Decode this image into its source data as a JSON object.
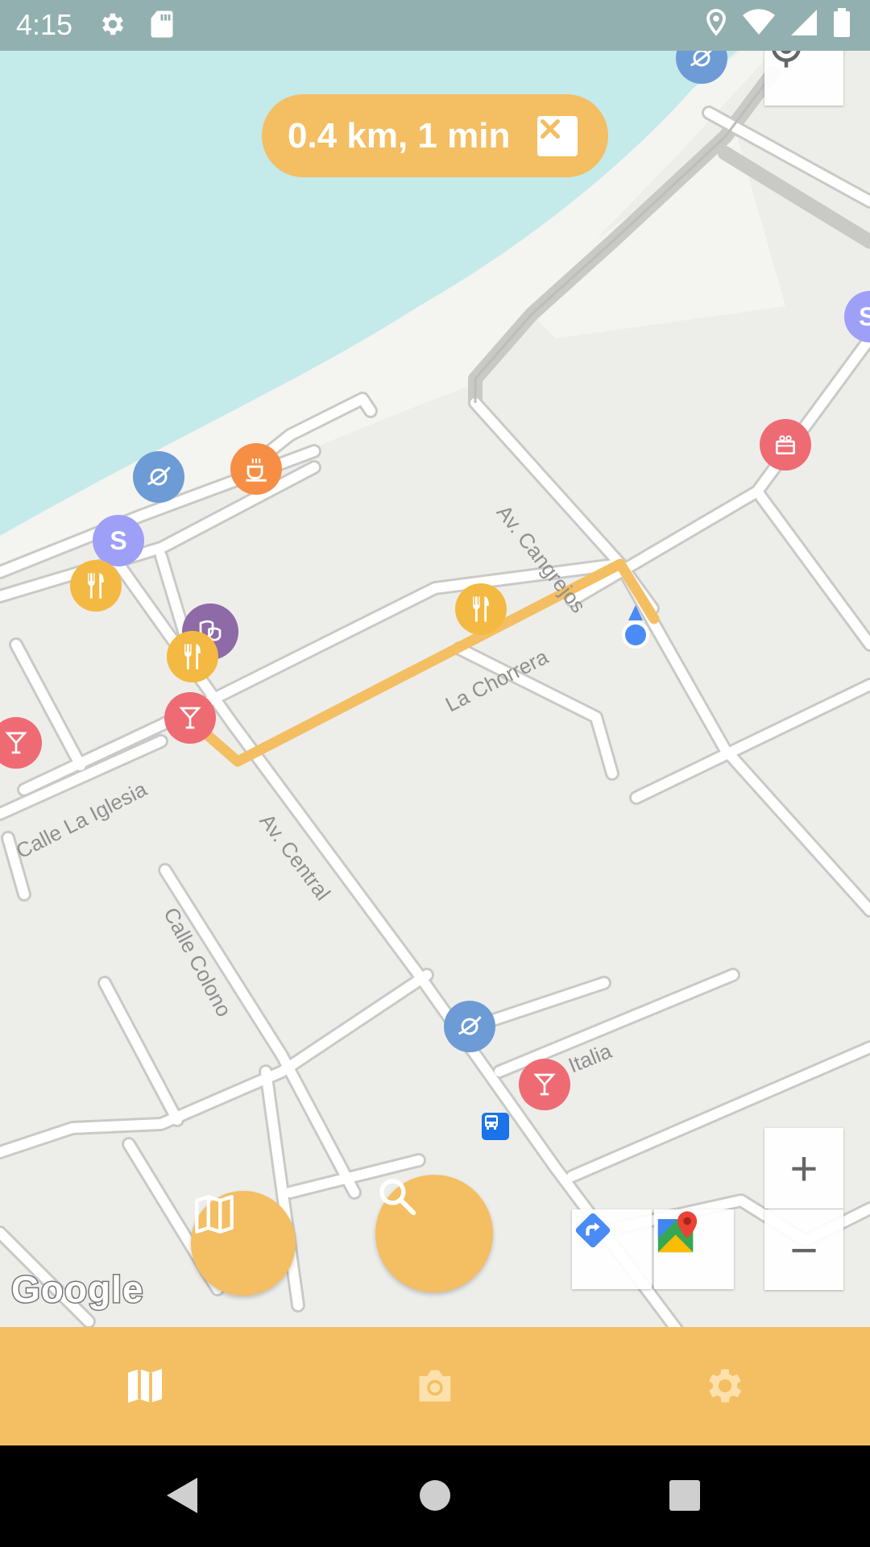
{
  "status_bar": {
    "time": "4:15",
    "left_icons": [
      "gear-icon",
      "sd-card-icon"
    ],
    "right_icons": [
      "location-pin-icon",
      "wifi-icon",
      "signal-icon",
      "battery-icon"
    ]
  },
  "map": {
    "route_summary": "0.4 km, 1 min",
    "street_labels": [
      "Av. Cangrejos",
      "La Chorrera",
      "Calle La Iglesia",
      "Av. Central",
      "Calle Colono",
      "Via Italia"
    ],
    "poi_letter": "S",
    "provider_logo": "Google",
    "colors": {
      "route": "#f4be62",
      "water": "#c4eaea",
      "land": "#edeeea",
      "road": "#ffffff",
      "poi_blue": "#6c9bd6",
      "poi_orange": "#f68f45",
      "poi_purple_s": "#9e9ff6",
      "poi_yellow": "#f4b942",
      "poi_theater": "#8e6aa6",
      "poi_red": "#ef6b73",
      "transit": "#1a73e8"
    }
  },
  "controls": {
    "my_location": "my-location-icon",
    "zoom_in": "+",
    "zoom_out": "−",
    "directions": "directions-icon",
    "open_in_maps": "google-maps-icon"
  },
  "fabs": {
    "map_layers": "map-icon",
    "search": "search-icon"
  },
  "bottom_nav": {
    "items": [
      "map-icon",
      "camera-icon",
      "settings-icon"
    ],
    "active": "map"
  },
  "system_nav": [
    "back",
    "home",
    "recents"
  ]
}
